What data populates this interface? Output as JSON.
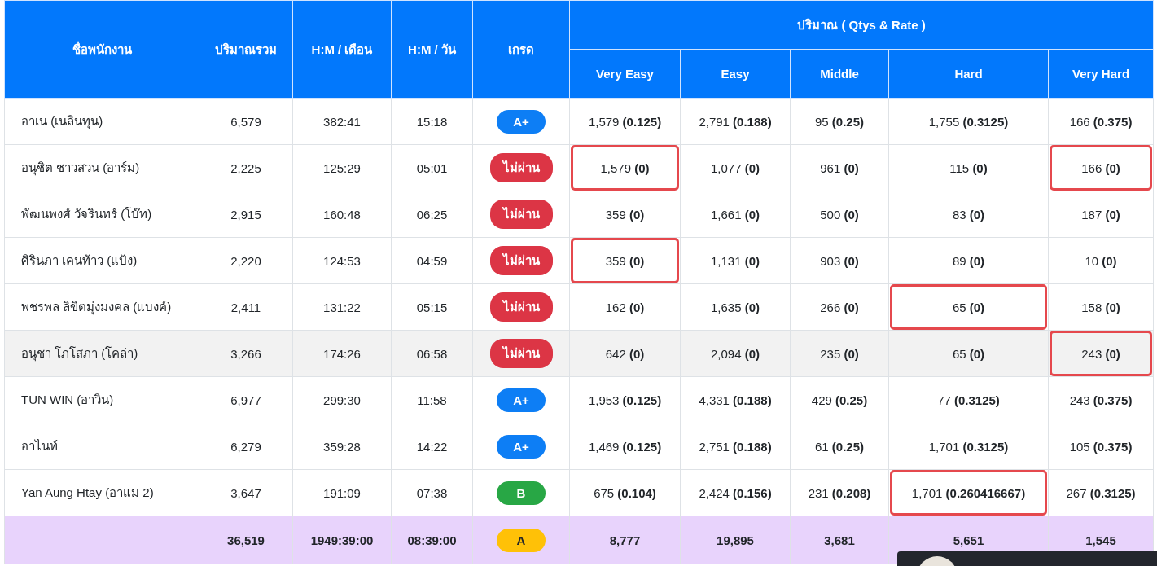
{
  "table": {
    "columns": [
      {
        "label": "ชื่อพนักงาน"
      },
      {
        "label": "ปริมาณรวม"
      },
      {
        "label": "H:M / เดือน"
      },
      {
        "label": "H:M / วัน"
      },
      {
        "label": "เกรด"
      }
    ],
    "group_header": "ปริมาณ ( Qtys & Rate )",
    "sub_columns": [
      "Very Easy",
      "Easy",
      "Middle",
      "Hard",
      "Very Hard"
    ],
    "rows": [
      {
        "name": "อาเน (เนลินทุน)",
        "total": "6,579",
        "hm_month": "382:41",
        "hm_day": "15:18",
        "grade": {
          "label": "A+",
          "color": "#0d7ef5"
        },
        "hovered": false,
        "cells": [
          {
            "text": "1,579 **(0.125)**",
            "highlighted": false
          },
          {
            "text": "2,791 **(0.188)**",
            "highlighted": false
          },
          {
            "text": "95 **(0.25)**",
            "highlighted": false
          },
          {
            "text": "1,755 **(0.3125)**",
            "highlighted": false
          },
          {
            "text": "166 **(0.375)**",
            "highlighted": false
          }
        ]
      },
      {
        "name": "อนุชิต ชาวสวน (อาร์ม)",
        "total": "2,225",
        "hm_month": "125:29",
        "hm_day": "05:01",
        "grade": {
          "label": "ไม่ผ่าน",
          "color": "#dc3545"
        },
        "hovered": false,
        "cells": [
          {
            "text": "1,579 **(0)**",
            "highlighted": true
          },
          {
            "text": "1,077 **(0)**",
            "highlighted": false
          },
          {
            "text": "961 **(0)**",
            "highlighted": false
          },
          {
            "text": "115 **(0)**",
            "highlighted": false
          },
          {
            "text": "166 **(0)**",
            "highlighted": true
          }
        ]
      },
      {
        "name": "พัฒนพงศ์ วัจรินทร์ (โบ๊ท)",
        "total": "2,915",
        "hm_month": "160:48",
        "hm_day": "06:25",
        "grade": {
          "label": "ไม่ผ่าน",
          "color": "#dc3545"
        },
        "hovered": false,
        "cells": [
          {
            "text": "359 **(0)**",
            "highlighted": false
          },
          {
            "text": "1,661 **(0)**",
            "highlighted": false
          },
          {
            "text": "500 **(0)**",
            "highlighted": false
          },
          {
            "text": "83 **(0)**",
            "highlighted": false
          },
          {
            "text": "187 **(0)**",
            "highlighted": false
          }
        ]
      },
      {
        "name": "ศิรินภา เคนท้าว (แป้ง)",
        "total": "2,220",
        "hm_month": "124:53",
        "hm_day": "04:59",
        "grade": {
          "label": "ไม่ผ่าน",
          "color": "#dc3545"
        },
        "hovered": false,
        "cells": [
          {
            "text": "359 **(0)**",
            "highlighted": true
          },
          {
            "text": "1,131 **(0)**",
            "highlighted": false
          },
          {
            "text": "903 **(0)**",
            "highlighted": false
          },
          {
            "text": "89 **(0)**",
            "highlighted": false
          },
          {
            "text": "10 **(0)**",
            "highlighted": false
          }
        ]
      },
      {
        "name": "พชรพล ลิขิตมุ่งมงคล (แบงค์)",
        "total": "2,411",
        "hm_month": "131:22",
        "hm_day": "05:15",
        "grade": {
          "label": "ไม่ผ่าน",
          "color": "#dc3545"
        },
        "hovered": false,
        "cells": [
          {
            "text": "162 **(0)**",
            "highlighted": false
          },
          {
            "text": "1,635 **(0)**",
            "highlighted": false
          },
          {
            "text": "266 **(0)**",
            "highlighted": false
          },
          {
            "text": "65 **(0)**",
            "highlighted": true
          },
          {
            "text": "158 **(0)**",
            "highlighted": false
          }
        ]
      },
      {
        "name": "อนุชา โภโสภา (โคล่า)",
        "total": "3,266",
        "hm_month": "174:26",
        "hm_day": "06:58",
        "grade": {
          "label": "ไม่ผ่าน",
          "color": "#dc3545"
        },
        "hovered": true,
        "cells": [
          {
            "text": "642 **(0)**",
            "highlighted": false
          },
          {
            "text": "2,094 **(0)**",
            "highlighted": false
          },
          {
            "text": "235 **(0)**",
            "highlighted": false
          },
          {
            "text": "65 **(0)**",
            "highlighted": false
          },
          {
            "text": "243 **(0)**",
            "highlighted": true
          }
        ]
      },
      {
        "name": "TUN WIN (อาวิน)",
        "total": "6,977",
        "hm_month": "299:30",
        "hm_day": "11:58",
        "grade": {
          "label": "A+",
          "color": "#0d7ef5"
        },
        "hovered": false,
        "cells": [
          {
            "text": "1,953 **(0.125)**",
            "highlighted": false
          },
          {
            "text": "4,331 **(0.188)**",
            "highlighted": false
          },
          {
            "text": "429 **(0.25)**",
            "highlighted": false
          },
          {
            "text": "77 **(0.3125)**",
            "highlighted": false
          },
          {
            "text": "243 **(0.375)**",
            "highlighted": false
          }
        ]
      },
      {
        "name": "อาไนท์",
        "total": "6,279",
        "hm_month": "359:28",
        "hm_day": "14:22",
        "grade": {
          "label": "A+",
          "color": "#0d7ef5"
        },
        "hovered": false,
        "cells": [
          {
            "text": "1,469 **(0.125)**",
            "highlighted": false
          },
          {
            "text": "2,751 **(0.188)**",
            "highlighted": false
          },
          {
            "text": "61 **(0.25)**",
            "highlighted": false
          },
          {
            "text": "1,701 **(0.3125)**",
            "highlighted": false
          },
          {
            "text": "105 **(0.375)**",
            "highlighted": false
          }
        ]
      },
      {
        "name": "Yan Aung Htay (อาแม 2)",
        "total": "3,647",
        "hm_month": "191:09",
        "hm_day": "07:38",
        "grade": {
          "label": "B",
          "color": "#28a745"
        },
        "hovered": false,
        "cells": [
          {
            "text": "675 **(0.104)**",
            "highlighted": false
          },
          {
            "text": "2,424 **(0.156)**",
            "highlighted": false
          },
          {
            "text": "231 **(0.208)**",
            "highlighted": false
          },
          {
            "text": "1,701 **(0.260416667)**",
            "highlighted": true
          },
          {
            "text": "267 **(0.3125)**",
            "highlighted": false
          }
        ]
      }
    ],
    "totals": {
      "total": "36,519",
      "hm_month": "1949:39:00",
      "hm_day": "08:39:00",
      "grade": {
        "label": "A",
        "color": "#ffc107"
      },
      "cells": [
        "8,777",
        "19,895",
        "3,681",
        "5,651",
        "1,545"
      ]
    }
  }
}
